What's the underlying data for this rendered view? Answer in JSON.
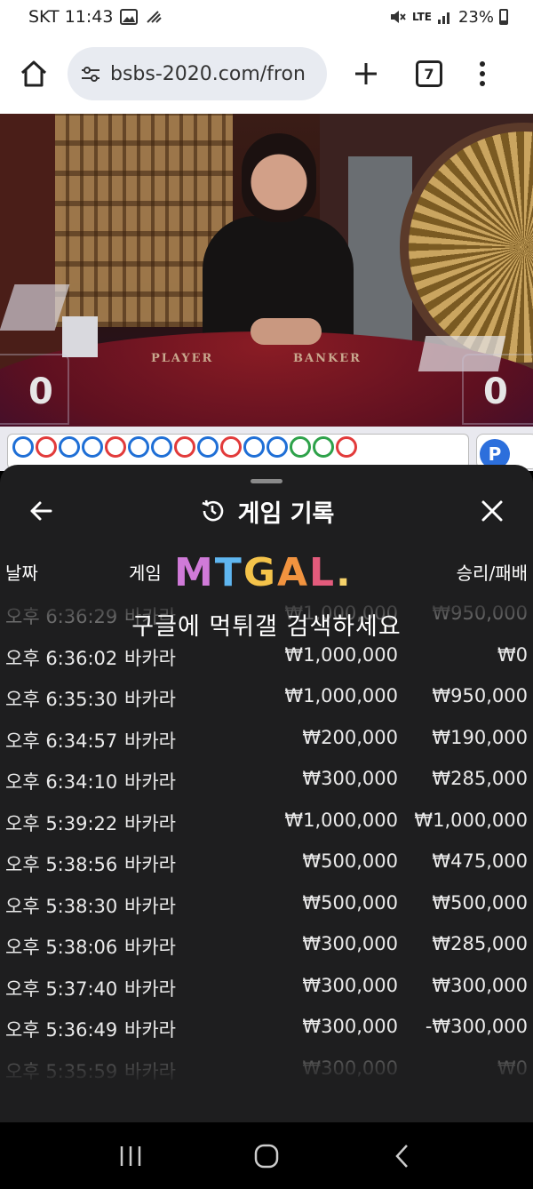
{
  "status_bar": {
    "carrier_time": "SKT 11:43",
    "network": "LTE",
    "battery": "23%"
  },
  "browser": {
    "url": "bsbs-2020.com/fron",
    "tab_count": "7"
  },
  "video": {
    "player_label": "PLAYER",
    "banker_label": "BANKER",
    "player_score": "0",
    "banker_score": "0"
  },
  "road": {
    "badge": "P",
    "beads": [
      "b",
      "r",
      "b",
      "b",
      "r",
      "b",
      "b",
      "r",
      "b",
      "r",
      "b",
      "b",
      "g",
      "g",
      "r"
    ]
  },
  "sheet": {
    "title": "게임 기록",
    "columns": {
      "date": "날짜",
      "game": "게임",
      "result": "승리/패배"
    },
    "watermark_logo": [
      "M",
      "T",
      "G",
      "A",
      "L",
      "."
    ],
    "watermark_text": "구글에 먹튀갤 검색하세요",
    "rows": [
      {
        "time": "오후 6:36:29",
        "game": "바카라",
        "bet": "₩1,000,000",
        "result": "₩950,000",
        "faded": true
      },
      {
        "time": "오후 6:36:02",
        "game": "바카라",
        "bet": "₩1,000,000",
        "result": "₩0"
      },
      {
        "time": "오후 6:35:30",
        "game": "바카라",
        "bet": "₩1,000,000",
        "result": "₩950,000"
      },
      {
        "time": "오후 6:34:57",
        "game": "바카라",
        "bet": "₩200,000",
        "result": "₩190,000"
      },
      {
        "time": "오후 6:34:10",
        "game": "바카라",
        "bet": "₩300,000",
        "result": "₩285,000"
      },
      {
        "time": "오후 5:39:22",
        "game": "바카라",
        "bet": "₩1,000,000",
        "result": "₩1,000,000"
      },
      {
        "time": "오후 5:38:56",
        "game": "바카라",
        "bet": "₩500,000",
        "result": "₩475,000"
      },
      {
        "time": "오후 5:38:30",
        "game": "바카라",
        "bet": "₩500,000",
        "result": "₩500,000"
      },
      {
        "time": "오후 5:38:06",
        "game": "바카라",
        "bet": "₩300,000",
        "result": "₩285,000"
      },
      {
        "time": "오후 5:37:40",
        "game": "바카라",
        "bet": "₩300,000",
        "result": "₩300,000"
      },
      {
        "time": "오후 5:36:49",
        "game": "바카라",
        "bet": "₩300,000",
        "result": "-₩300,000"
      },
      {
        "time": "오후 5:35:59",
        "game": "바카라",
        "bet": "₩300,000",
        "result": "₩0",
        "faded": true
      }
    ]
  }
}
